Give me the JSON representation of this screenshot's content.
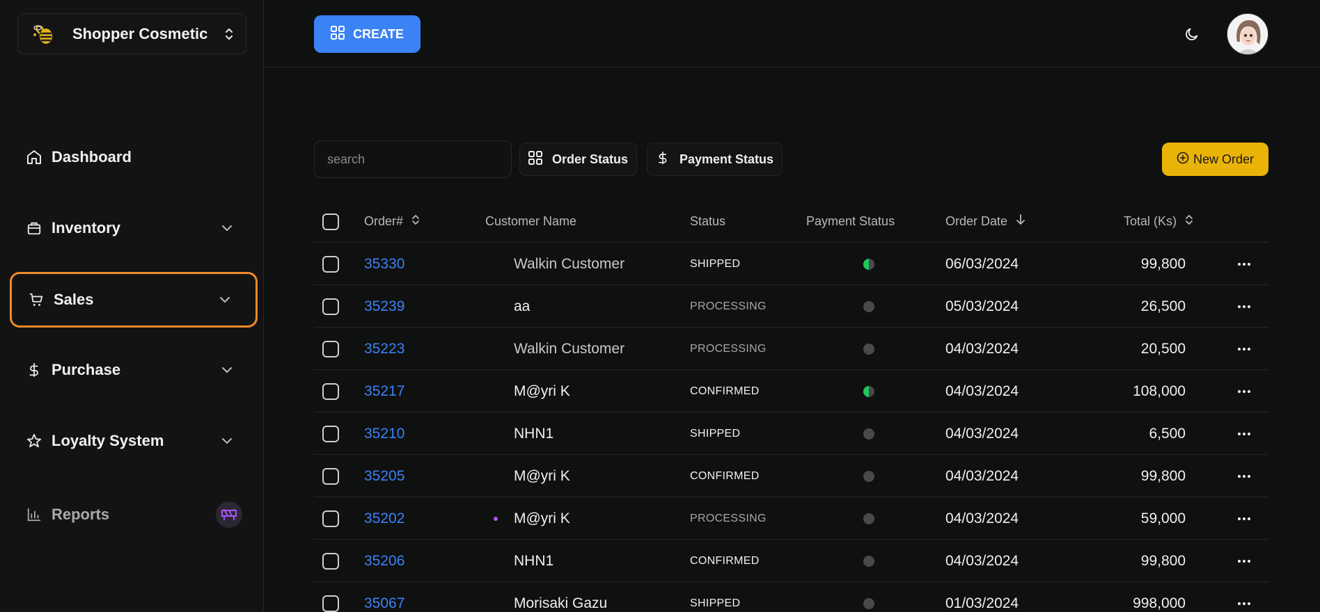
{
  "brand": {
    "name": "Shopper Cosmetic"
  },
  "sidebar": {
    "items": [
      {
        "label": "Dashboard",
        "icon": "home-icon"
      },
      {
        "label": "Inventory",
        "icon": "package-icon"
      },
      {
        "label": "Sales",
        "icon": "cart-icon"
      },
      {
        "label": "Purchase",
        "icon": "dollar-icon"
      },
      {
        "label": "Loyalty System",
        "icon": "star-icon"
      },
      {
        "label": "Reports",
        "icon": "bar-chart-icon"
      }
    ]
  },
  "topbar": {
    "create_label": "CREATE"
  },
  "filters": {
    "search_placeholder": "search",
    "order_status_label": "Order Status",
    "payment_status_label": "Payment Status",
    "new_order_label": "New Order"
  },
  "table": {
    "headers": {
      "order": "Order#",
      "customer": "Customer Name",
      "status": "Status",
      "payment": "Payment Status",
      "date": "Order Date",
      "total": "Total (Ks)"
    },
    "rows": [
      {
        "order": "35330",
        "customer": "Walkin Customer",
        "status": "SHIPPED",
        "payment": "partial",
        "date": "06/03/2024",
        "total": "99,800"
      },
      {
        "order": "35239",
        "customer": "aa",
        "status": "PROCESSING",
        "payment": "unpaid",
        "date": "05/03/2024",
        "total": "26,500"
      },
      {
        "order": "35223",
        "customer": "Walkin Customer",
        "status": "PROCESSING",
        "payment": "unpaid",
        "date": "04/03/2024",
        "total": "20,500"
      },
      {
        "order": "35217",
        "customer": "M@yri K",
        "status": "CONFIRMED",
        "payment": "partial",
        "date": "04/03/2024",
        "total": "108,000"
      },
      {
        "order": "35210",
        "customer": "NHN1",
        "status": "SHIPPED",
        "payment": "unpaid",
        "date": "04/03/2024",
        "total": "6,500"
      },
      {
        "order": "35205",
        "customer": "M@yri K",
        "status": "CONFIRMED",
        "payment": "unpaid",
        "date": "04/03/2024",
        "total": "99,800"
      },
      {
        "order": "35202",
        "customer": "M@yri K",
        "status": "PROCESSING",
        "payment": "unpaid",
        "date": "04/03/2024",
        "total": "59,000"
      },
      {
        "order": "35206",
        "customer": "NHN1",
        "status": "CONFIRMED",
        "payment": "unpaid",
        "date": "04/03/2024",
        "total": "99,800"
      },
      {
        "order": "35067",
        "customer": "Morisaki Gazu",
        "status": "SHIPPED",
        "payment": "unpaid",
        "date": "01/03/2024",
        "total": "998,000"
      }
    ]
  },
  "colors": {
    "accent_blue": "#3b82f6",
    "accent_yellow": "#eab308",
    "highlight_orange": "#f08a2c",
    "paid_green": "#22c55e"
  }
}
